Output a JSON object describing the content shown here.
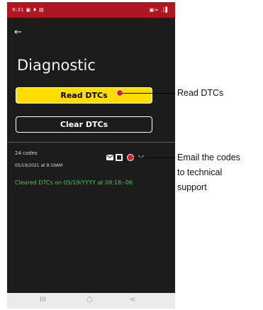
{
  "status_bar": {
    "time": "9:31",
    "left_icons": "▣ ♦ ▤",
    "right_icons": "▣≈ .│▌"
  },
  "screen": {
    "back_icon": "←",
    "title": "Diagnostic",
    "read_button_label": "Read DTCs",
    "clear_button_label": "Clear DTCs",
    "code_count": "24 codes",
    "code_timestamp": "05/19/2021 at 9:19AM",
    "cleared_message": "Cleared DTCs on 05/19/YYYY at 09:18:-06"
  },
  "nav_bar": {
    "recents": "III",
    "home": "○",
    "back": "<"
  },
  "callouts": {
    "read": "Read DTCs",
    "email_line1": "Email the codes",
    "email_line2": "to technical",
    "email_line3": "support"
  },
  "colors": {
    "status_bar": "#b01621",
    "background": "#1c1c1c",
    "read_button": "#ffdd00",
    "cleared_text": "#4ec553",
    "callout_dot": "#e02020"
  }
}
